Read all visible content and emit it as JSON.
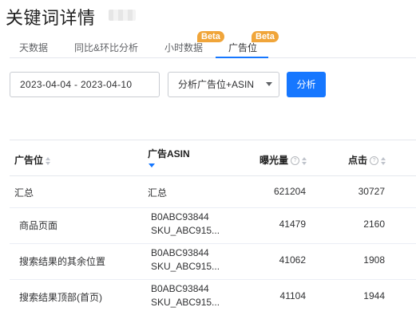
{
  "page": {
    "title": "关键词详情"
  },
  "tabs": [
    {
      "label": "天数据",
      "badge": ""
    },
    {
      "label": "同比&环比分析",
      "badge": ""
    },
    {
      "label": "小时数据",
      "badge": "Beta"
    },
    {
      "label": "广告位",
      "badge": "Beta",
      "active": true
    }
  ],
  "filters": {
    "date_range": "2023-04-04 - 2023-04-10",
    "mode_select": "分析广告位+ASIN",
    "analyze_button": "分析"
  },
  "table": {
    "columns": [
      "广告位",
      "广告ASIN",
      "曝光量",
      "点击"
    ],
    "rows": [
      {
        "placement": "汇总",
        "asin": "汇总",
        "sku": "",
        "impressions": "621204",
        "clicks": "30727"
      },
      {
        "placement": "商品页面",
        "asin": "B0ABC93844",
        "sku": "SKU_ABC915...",
        "impressions": "41479",
        "clicks": "2160"
      },
      {
        "placement": "搜索结果的其余位置",
        "asin": "B0ABC93844",
        "sku": "SKU_ABC915...",
        "impressions": "41062",
        "clicks": "1908"
      },
      {
        "placement": "搜索结果顶部(首页)",
        "asin": "B0ABC93844",
        "sku": "SKU_ABC915...",
        "impressions": "41104",
        "clicks": "1944"
      }
    ]
  },
  "colors": {
    "primary": "#1677ff",
    "badge": "#f0a53a"
  },
  "icons": {
    "help": "question-circle-icon",
    "sort": "sort-caret-icon",
    "dropdown": "chevron-down-icon"
  }
}
